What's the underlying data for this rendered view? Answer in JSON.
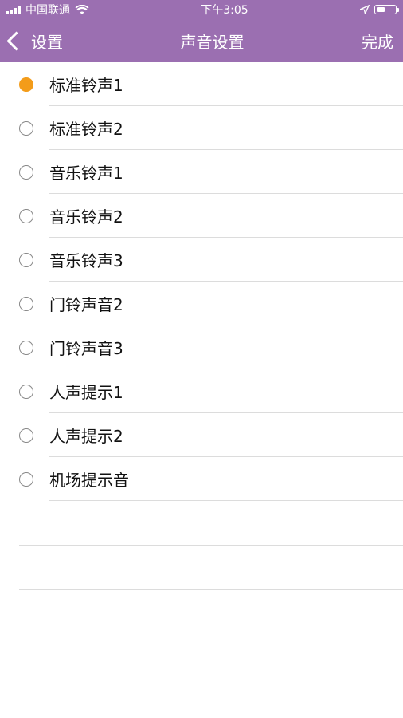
{
  "status_bar": {
    "carrier": "中国联通",
    "time": "下午3:05"
  },
  "nav": {
    "back_label": "设置",
    "title": "声音设置",
    "done_label": "完成"
  },
  "sound_options": [
    {
      "label": "标准铃声1",
      "selected": true
    },
    {
      "label": "标准铃声2",
      "selected": false
    },
    {
      "label": "音乐铃声1",
      "selected": false
    },
    {
      "label": "音乐铃声2",
      "selected": false
    },
    {
      "label": "音乐铃声3",
      "selected": false
    },
    {
      "label": "门铃声音2",
      "selected": false
    },
    {
      "label": "门铃声音3",
      "selected": false
    },
    {
      "label": "人声提示1",
      "selected": false
    },
    {
      "label": "人声提示2",
      "selected": false
    },
    {
      "label": "机场提示音",
      "selected": false
    }
  ],
  "colors": {
    "header_bg": "#9b6fb1",
    "selected_radio": "#f39c1a"
  }
}
